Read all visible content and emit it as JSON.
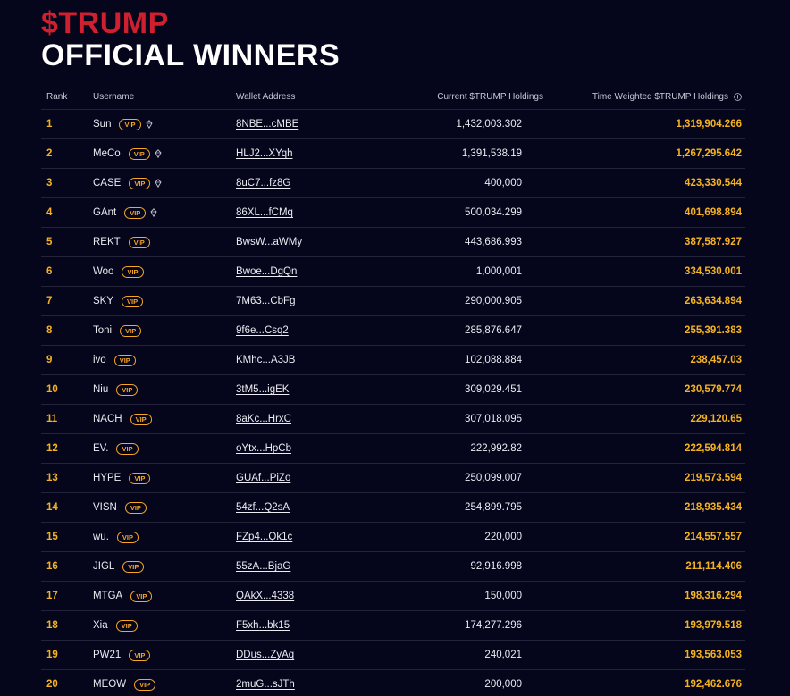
{
  "hero": {
    "ticker": "$TRUMP",
    "title": "OFFICIAL WINNERS"
  },
  "table": {
    "headers": {
      "rank": "Rank",
      "username": "Username",
      "wallet": "Wallet Address",
      "holdings": "Current $TRUMP Holdings",
      "time_weighted": "Time Weighted $TRUMP Holdings",
      "info_icon": "info-icon"
    },
    "badge": "VIP",
    "rows": [
      {
        "rank": "1",
        "username": "Sun",
        "gem": true,
        "wallet": "8NBE...cMBE",
        "holdings": "1,432,003.302",
        "time_weighted": "1,319,904.266"
      },
      {
        "rank": "2",
        "username": "MeCo",
        "gem": true,
        "wallet": "HLJ2...XYqh",
        "holdings": "1,391,538.19",
        "time_weighted": "1,267,295.642"
      },
      {
        "rank": "3",
        "username": "CASE",
        "gem": true,
        "wallet": "8uC7...fz8G",
        "holdings": "400,000",
        "time_weighted": "423,330.544"
      },
      {
        "rank": "4",
        "username": "GAnt",
        "gem": true,
        "wallet": "86XL...fCMq",
        "holdings": "500,034.299",
        "time_weighted": "401,698.894"
      },
      {
        "rank": "5",
        "username": "REKT",
        "gem": false,
        "wallet": "BwsW...aWMy",
        "holdings": "443,686.993",
        "time_weighted": "387,587.927"
      },
      {
        "rank": "6",
        "username": "Woo",
        "gem": false,
        "wallet": "Bwoe...DgQn",
        "holdings": "1,000,001",
        "time_weighted": "334,530.001"
      },
      {
        "rank": "7",
        "username": "SKY",
        "gem": false,
        "wallet": "7M63...CbFg",
        "holdings": "290,000.905",
        "time_weighted": "263,634.894"
      },
      {
        "rank": "8",
        "username": "Toni",
        "gem": false,
        "wallet": "9f6e...Csq2",
        "holdings": "285,876.647",
        "time_weighted": "255,391.383"
      },
      {
        "rank": "9",
        "username": "ivo",
        "gem": false,
        "wallet": "KMhc...A3JB",
        "holdings": "102,088.884",
        "time_weighted": "238,457.03"
      },
      {
        "rank": "10",
        "username": "Niu",
        "gem": false,
        "wallet": "3tM5...igEK",
        "holdings": "309,029.451",
        "time_weighted": "230,579.774"
      },
      {
        "rank": "11",
        "username": "NACH",
        "gem": false,
        "wallet": "8aKc...HrxC",
        "holdings": "307,018.095",
        "time_weighted": "229,120.65"
      },
      {
        "rank": "12",
        "username": "EV.",
        "gem": false,
        "wallet": "oYtx...HpCb",
        "holdings": "222,992.82",
        "time_weighted": "222,594.814"
      },
      {
        "rank": "13",
        "username": "HYPE",
        "gem": false,
        "wallet": "GUAf...PiZo",
        "holdings": "250,099.007",
        "time_weighted": "219,573.594"
      },
      {
        "rank": "14",
        "username": "VISN",
        "gem": false,
        "wallet": "54zf...Q2sA",
        "holdings": "254,899.795",
        "time_weighted": "218,935.434"
      },
      {
        "rank": "15",
        "username": "wu.",
        "gem": false,
        "wallet": "FZp4...Qk1c",
        "holdings": "220,000",
        "time_weighted": "214,557.557"
      },
      {
        "rank": "16",
        "username": "JIGL",
        "gem": false,
        "wallet": "55zA...BjaG",
        "holdings": "92,916.998",
        "time_weighted": "211,114.406"
      },
      {
        "rank": "17",
        "username": "MTGA",
        "gem": false,
        "wallet": "QAkX...4338",
        "holdings": "150,000",
        "time_weighted": "198,316.294"
      },
      {
        "rank": "18",
        "username": "Xia",
        "gem": false,
        "wallet": "F5xh...bk15",
        "holdings": "174,277.296",
        "time_weighted": "193,979.518"
      },
      {
        "rank": "19",
        "username": "PW21",
        "gem": false,
        "wallet": "DDus...ZyAq",
        "holdings": "240,021",
        "time_weighted": "193,563.053"
      },
      {
        "rank": "20",
        "username": "MEOW",
        "gem": false,
        "wallet": "2muG...sJTh",
        "holdings": "200,000",
        "time_weighted": "192,462.676"
      }
    ]
  },
  "colors": {
    "background": "#05051c",
    "ticker_red": "#d0202f",
    "accent_gold": "#f5b321",
    "badge_orange": "#f5a623"
  }
}
